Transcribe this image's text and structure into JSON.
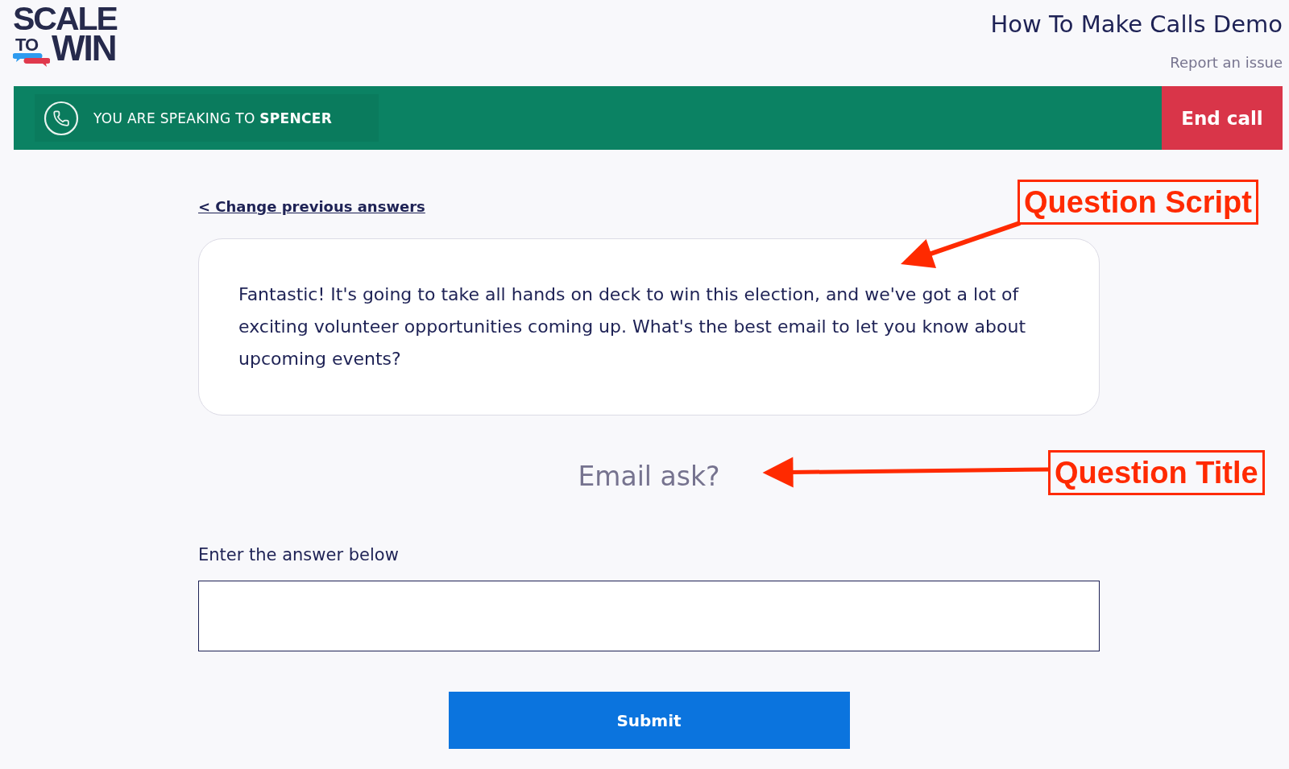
{
  "logo": {
    "top_line": "SCALE",
    "small_word": "TO",
    "bottom_word": "WIN"
  },
  "header": {
    "title": "How To Make Calls Demo",
    "report_link": "Report an issue"
  },
  "call_bar": {
    "status": "YOU ARE SPEAKING TO **SPENCER**",
    "end_button": "End call"
  },
  "back_link": "< Change previous answers",
  "script": "Fantastic! It's going to take all hands on deck to win this election, and we've got a lot of exciting volunteer opportunities coming up. What's the best email to let you know about upcoming events?",
  "question_title": "Email ask?",
  "answer": {
    "label": "Enter the answer below"
  },
  "submit_button": "Submit",
  "annotations": [
    {
      "label": "Question Script"
    },
    {
      "label": "Question Title"
    }
  ]
}
